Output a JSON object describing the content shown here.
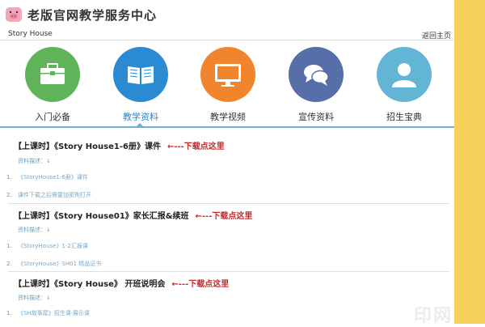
{
  "header": {
    "title": "老版官网教学服务中心"
  },
  "breadcrumb": "Story House",
  "back_link": "返回主页",
  "nav": [
    {
      "label": "入门必备",
      "color": "#5fb45a",
      "icon": "briefcase-icon",
      "active": false
    },
    {
      "label": "教学资料",
      "color": "#2a8bd2",
      "icon": "book-icon",
      "active": true
    },
    {
      "label": "教学视频",
      "color": "#f0852d",
      "icon": "monitor-icon",
      "active": false
    },
    {
      "label": "宣传资料",
      "color": "#566fa8",
      "icon": "chat-bubbles-icon",
      "active": false
    },
    {
      "label": "招生宝典",
      "color": "#63b5d6",
      "icon": "user-icon",
      "active": false
    }
  ],
  "sections": [
    {
      "title": "【上课时】《Story House1-6册》课件",
      "download": "←---下载点这里",
      "desc": "资料描述：↓",
      "items": [
        {
          "num": "1.",
          "text": "《StoryHouse1-6册》课件"
        },
        {
          "num": "2.",
          "text": "课件下载之后需要加密狗打开"
        }
      ]
    },
    {
      "title": "【上课时】《Story House01》家长汇报&续班",
      "download": "←---下载点这里",
      "desc": "资料描述：↓",
      "items": [
        {
          "num": "1.",
          "text": "《StoryHouse》1-2汇报课"
        },
        {
          "num": "2.",
          "text": "《StoryHouse》SH01   精品证书"
        }
      ]
    },
    {
      "title": "【上课时】《Story House》 开班说明会",
      "download": "←---下载点这里",
      "desc": "资料描述：↓",
      "items": [
        {
          "num": "1.",
          "text": "《SH故事屋》招生课·展示课"
        }
      ]
    }
  ],
  "watermark": "印网",
  "colors": {
    "accent": "#2a86c8",
    "download": "#c9282d",
    "side": "#f7d25a"
  }
}
